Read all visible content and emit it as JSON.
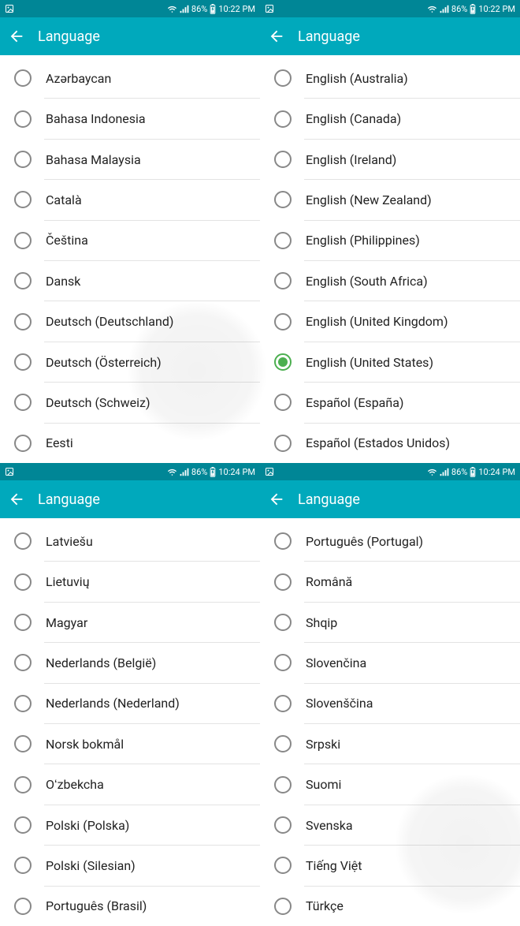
{
  "status": {
    "battery": "86%",
    "time_a": "10:22 PM",
    "time_b": "10:24 PM"
  },
  "appbar": {
    "title": "Language"
  },
  "panels": [
    {
      "time_key": "status.time_a",
      "items": [
        {
          "label": "Azərbaycan",
          "selected": false
        },
        {
          "label": "Bahasa Indonesia",
          "selected": false
        },
        {
          "label": "Bahasa Malaysia",
          "selected": false
        },
        {
          "label": "Català",
          "selected": false
        },
        {
          "label": "Čeština",
          "selected": false
        },
        {
          "label": "Dansk",
          "selected": false
        },
        {
          "label": "Deutsch (Deutschland)",
          "selected": false
        },
        {
          "label": "Deutsch (Österreich)",
          "selected": false
        },
        {
          "label": "Deutsch (Schweiz)",
          "selected": false
        },
        {
          "label": "Eesti",
          "selected": false
        }
      ]
    },
    {
      "time_key": "status.time_a",
      "items": [
        {
          "label": "English (Australia)",
          "selected": false
        },
        {
          "label": "English (Canada)",
          "selected": false
        },
        {
          "label": "English (Ireland)",
          "selected": false
        },
        {
          "label": "English (New Zealand)",
          "selected": false
        },
        {
          "label": "English (Philippines)",
          "selected": false
        },
        {
          "label": "English (South Africa)",
          "selected": false
        },
        {
          "label": "English (United Kingdom)",
          "selected": false
        },
        {
          "label": "English (United States)",
          "selected": true
        },
        {
          "label": "Español (España)",
          "selected": false
        },
        {
          "label": "Español (Estados Unidos)",
          "selected": false
        }
      ]
    },
    {
      "time_key": "status.time_b",
      "items": [
        {
          "label": "Latviešu",
          "selected": false
        },
        {
          "label": "Lietuvių",
          "selected": false
        },
        {
          "label": "Magyar",
          "selected": false
        },
        {
          "label": "Nederlands (België)",
          "selected": false
        },
        {
          "label": "Nederlands (Nederland)",
          "selected": false
        },
        {
          "label": "Norsk bokmål",
          "selected": false
        },
        {
          "label": "Oʻzbekcha",
          "selected": false
        },
        {
          "label": "Polski (Polska)",
          "selected": false
        },
        {
          "label": "Polski (Silesian)",
          "selected": false
        },
        {
          "label": "Português (Brasil)",
          "selected": false
        }
      ]
    },
    {
      "time_key": "status.time_b",
      "items": [
        {
          "label": "Português (Portugal)",
          "selected": false
        },
        {
          "label": "Română",
          "selected": false
        },
        {
          "label": "Shqip",
          "selected": false
        },
        {
          "label": "Slovenčina",
          "selected": false
        },
        {
          "label": "Slovenščina",
          "selected": false
        },
        {
          "label": "Srpski",
          "selected": false
        },
        {
          "label": "Suomi",
          "selected": false
        },
        {
          "label": "Svenska",
          "selected": false
        },
        {
          "label": "Tiếng Việt",
          "selected": false
        },
        {
          "label": "Türkçe",
          "selected": false
        }
      ]
    }
  ]
}
